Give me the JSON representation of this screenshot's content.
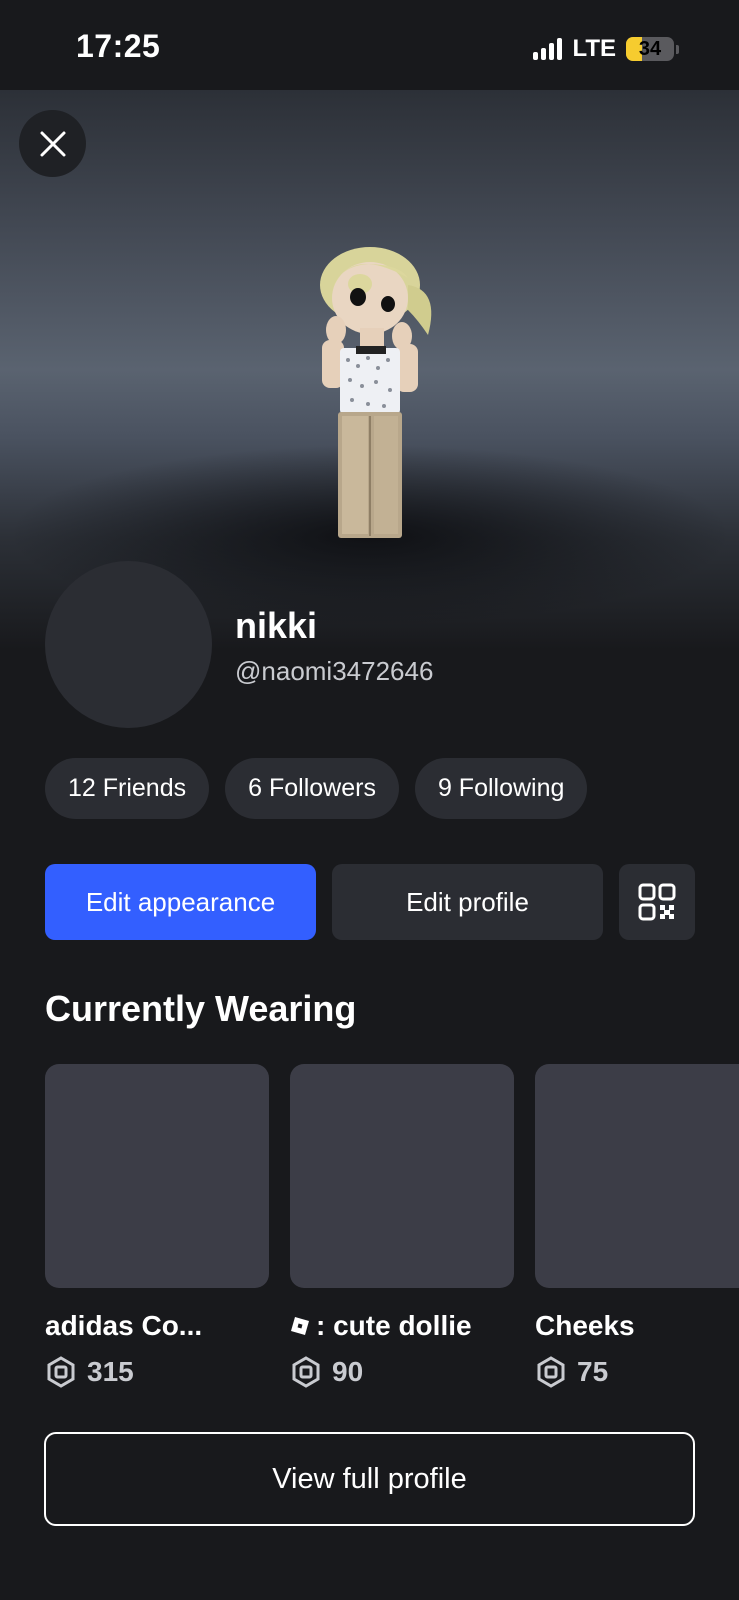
{
  "status_bar": {
    "time": "17:25",
    "network": "LTE",
    "battery": "34",
    "battery_level": 0.34
  },
  "profile": {
    "display_name": "nikki",
    "username": "@naomi3472646"
  },
  "stats": [
    {
      "label": "12 Friends"
    },
    {
      "label": "6 Followers"
    },
    {
      "label": "9 Following"
    }
  ],
  "actions": {
    "edit_appearance": "Edit appearance",
    "edit_profile": "Edit profile",
    "qr_icon": "qr-code-icon"
  },
  "currently_wearing": {
    "title": "Currently Wearing",
    "items": [
      {
        "name": "adidas Co...",
        "price": "315"
      },
      {
        "name": ": cute dollie",
        "price": "90"
      },
      {
        "name": "Cheeks",
        "price": "75"
      }
    ]
  },
  "footer": {
    "view_full_profile": "View full profile"
  },
  "colors": {
    "background": "#18191c",
    "primary": "#335fff",
    "pill": "#2b2d33",
    "thumb": "#3c3d47",
    "battery": "#f6cc2f"
  }
}
